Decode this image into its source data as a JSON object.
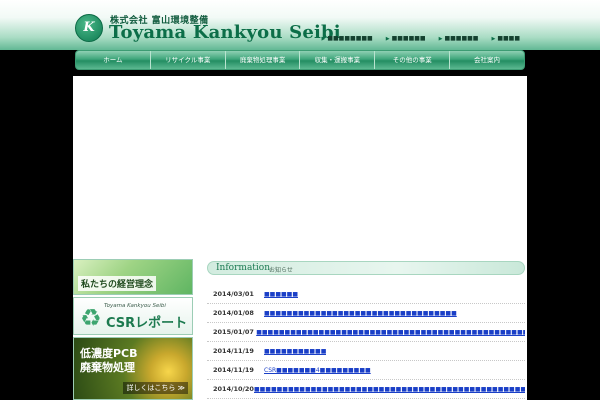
{
  "header": {
    "logo_glyph": "K",
    "company_jp": "株式会社 富山環境整備",
    "company_en": "Toyama Kankyou Seibi",
    "utility_links": [
      "■■■■■■■■",
      "■■■■■■",
      "■■■■■■",
      "■■■■"
    ]
  },
  "nav": {
    "items": [
      "ホーム",
      "リサイクル事業",
      "廃棄物処理事業",
      "収集・運搬事業",
      "その他の事業",
      "会社案内"
    ]
  },
  "sidebar": {
    "philosophy_label": "私たちの経営理念",
    "csr_small": "Toyama Kankyou Seibi",
    "csr_big": "CSRレポート",
    "pcb_line1": "低濃度PCB",
    "pcb_line2": "廃棄物処理",
    "pcb_more": "詳しくはこちら ≫"
  },
  "info": {
    "title": "Information",
    "subtitle": "お知らせ",
    "items": [
      {
        "date": "2014/03/01",
        "title": "■■■■■■"
      },
      {
        "date": "2014/01/08",
        "title": "■■■■■■■■■■■■■■■■■■■■■■■■■■■■■■■■■■"
      },
      {
        "date": "2015/01/07",
        "title": "■■■■■■■■■■■■■■■■■■■■■■■■■■■■■■■■■■■■■■■■■■■■■■■■■■■■■■■■"
      },
      {
        "date": "2014/11/19",
        "title": "■■■■■■■■■■■"
      },
      {
        "date": "2014/11/19",
        "title": "CSR■■■■■■■4■■■■■■■■■"
      },
      {
        "date": "2014/10/20",
        "title": "■■■■■■■■■■■■■■■■■■■■■■■■■■■■■■■■■■■■■■■■■■■■■■■■■■■■■■■■■■■■■■■■■■■■■■■■■"
      }
    ]
  },
  "colors": {
    "brand_green": "#0c6e48",
    "nav_green": "#3ea67b",
    "link_blue": "#1a3fc7",
    "page_bg": "#000000"
  }
}
